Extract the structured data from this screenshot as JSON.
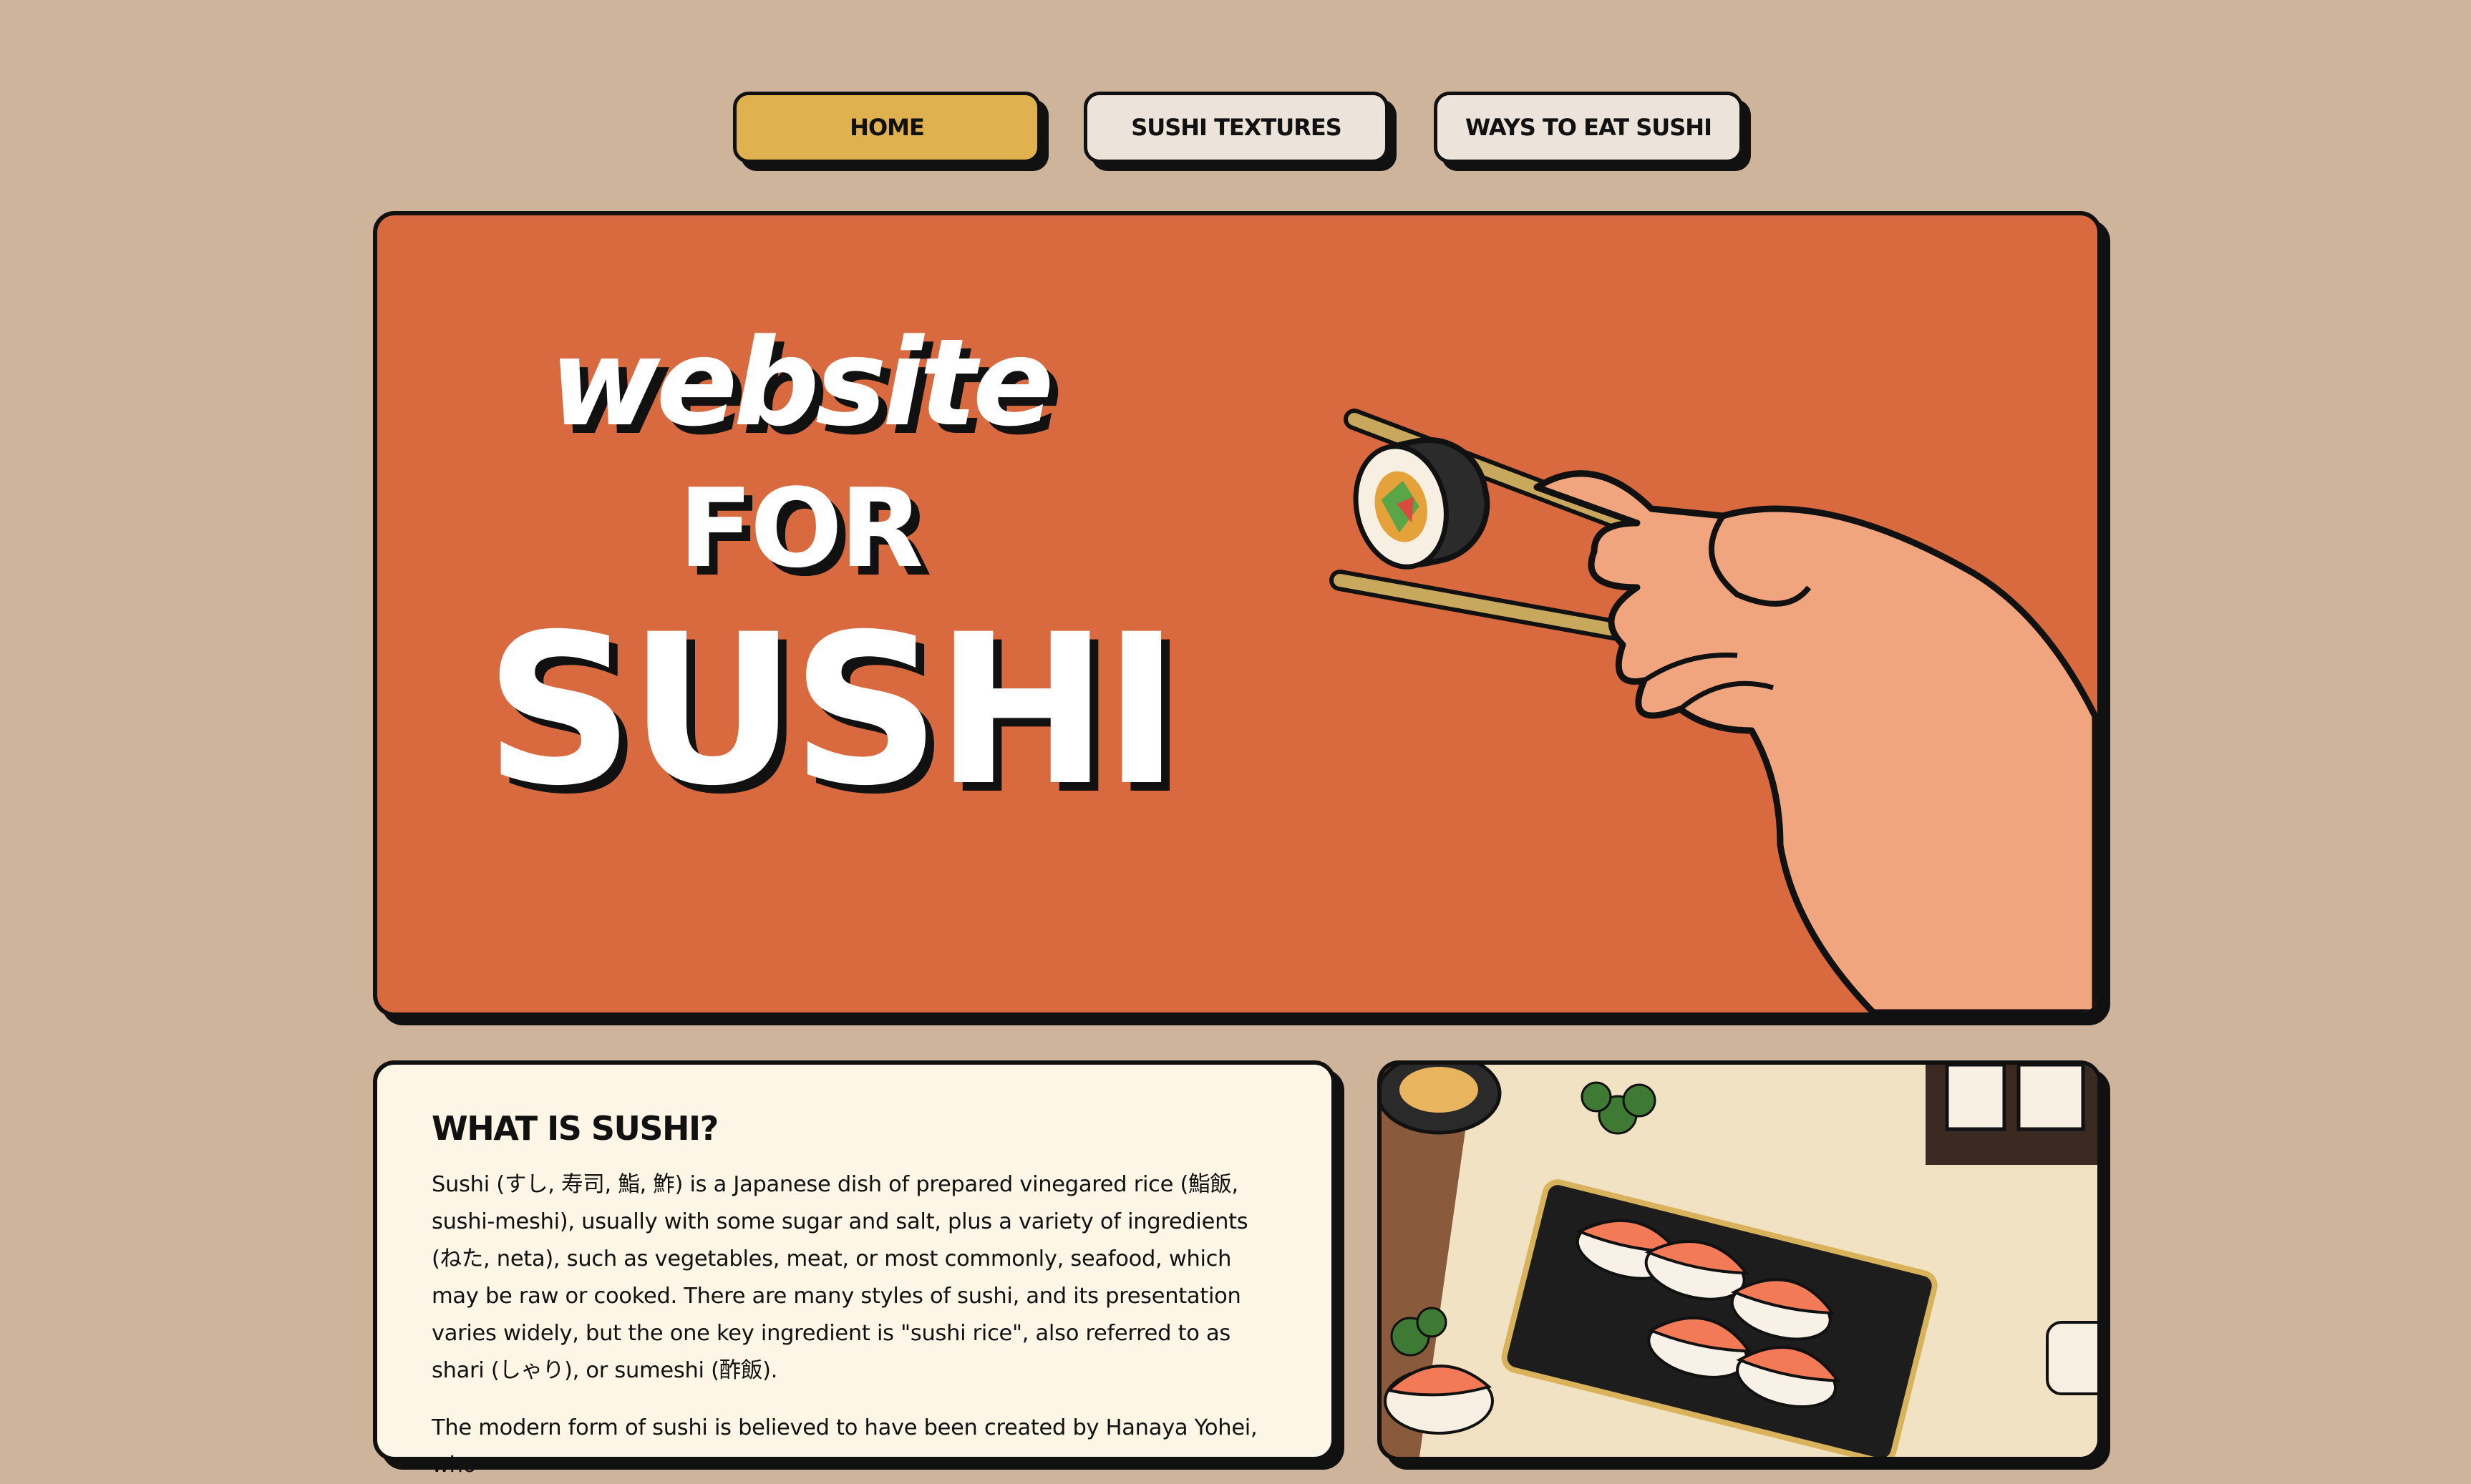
{
  "nav": {
    "home": "HOME",
    "textures": "SUSHI TEXTURES",
    "ways": "WAYS TO EAT SUSHI"
  },
  "hero": {
    "line1": "website",
    "line2": "FOR",
    "line3": "SUSHI",
    "illustration": "hand-holding-sushi-with-chopsticks"
  },
  "about": {
    "heading": "WHAT IS SUSHI?",
    "paragraph1": "Sushi (すし, 寿司, 鮨, 鮓) is a Japanese dish of prepared vinegared rice (鮨飯, sushi-meshi), usually with some sugar and salt, plus a variety of ingredients (ねた, neta), such as vegetables, meat, or most commonly, seafood, which may be raw or cooked. There are many styles of sushi, and its presentation varies widely, but the one key ingredient is \"sushi rice\", also referred to as shari (しゃり), or sumeshi (酢飯).",
    "paragraph2": "The modern form of sushi is believed to have been created by Hanaya Yohei, who"
  },
  "photo": {
    "subject": "sushi-platter-illustration"
  },
  "colors": {
    "page_bg": "#ceb49a",
    "hero_bg": "#d96a40",
    "home_btn": "#e0b14f",
    "nav_btn": "#ece3da",
    "card_bg": "#fdf6e7",
    "outline": "#111111"
  }
}
